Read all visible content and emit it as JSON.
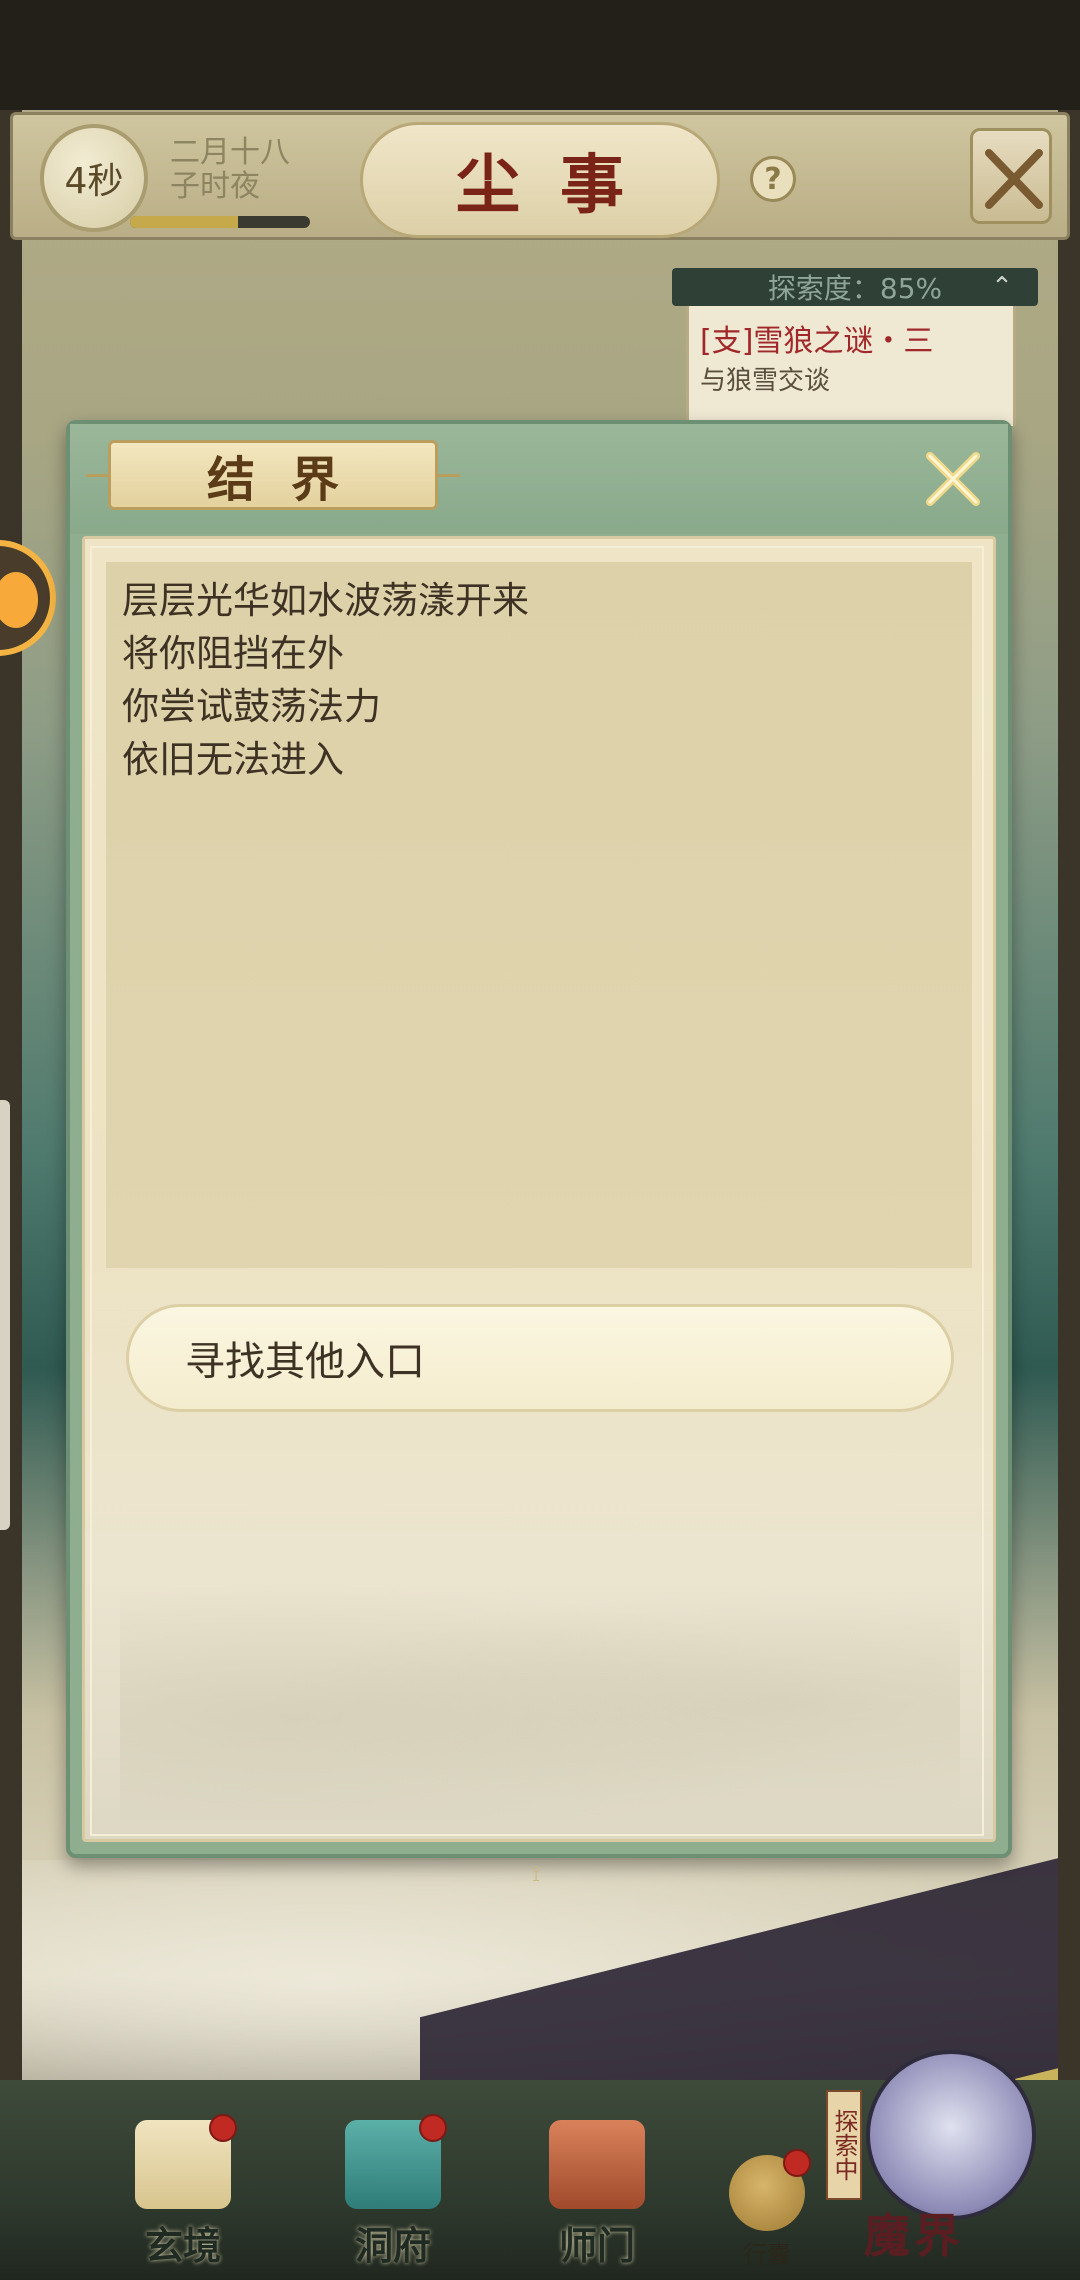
{
  "top_bar": {
    "timer": "4秒",
    "date_line1": "二月十八",
    "date_line2": "子时夜",
    "date_progress": 0.6,
    "title": "尘事",
    "help": "?"
  },
  "explore": {
    "progress_text": "探索度：85%",
    "quest_title": "[支]雪狼之谜・三",
    "quest_subtitle": "与狼雪交谈"
  },
  "modal": {
    "title": "结界",
    "lines": [
      "层层光华如水波荡漾开来",
      "将你阻挡在外",
      "你尝试鼓荡法力",
      "依旧无法进入"
    ],
    "choice": "寻找其他入口"
  },
  "bottom_nav": {
    "items": [
      {
        "label": "玄境",
        "badge": true
      },
      {
        "label": "洞府",
        "badge": true
      },
      {
        "label": "师门",
        "badge": false
      }
    ],
    "bag_label": "行囊",
    "realm_label": "魔界",
    "realm_status": "探索中"
  },
  "colors": {
    "title_red": "#7a2418",
    "quest_red": "#a1282a",
    "modal_green": "#8fae8f",
    "paper": "#efe5c6"
  }
}
